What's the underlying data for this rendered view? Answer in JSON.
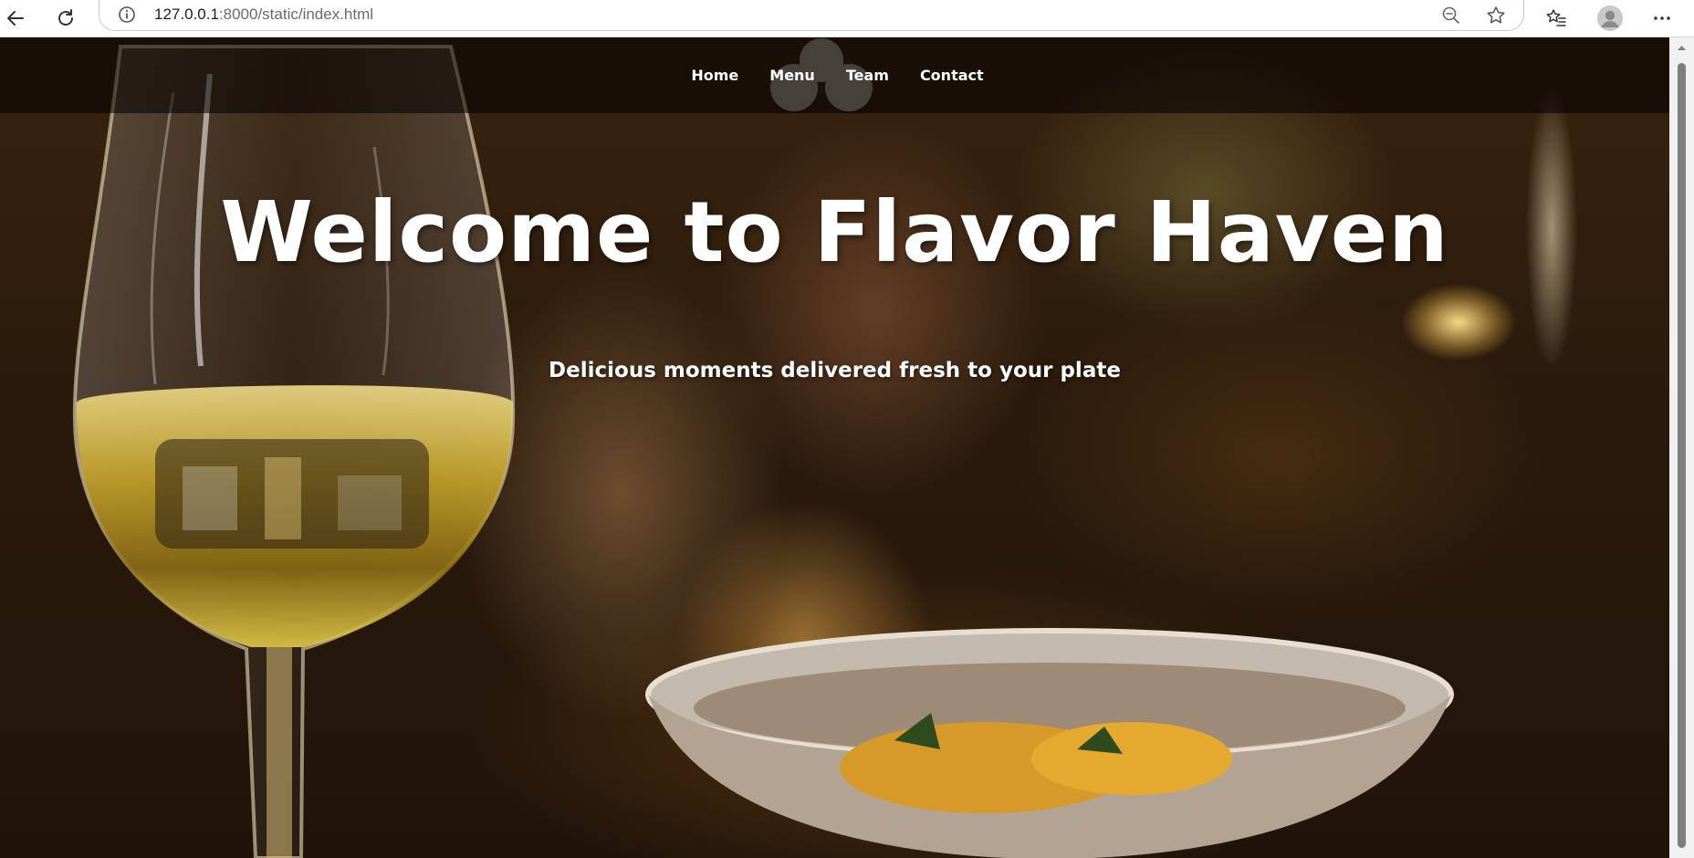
{
  "browser": {
    "url_host": "127.0.0.1",
    "url_rest": ":8000/static/index.html",
    "icons": [
      "back-arrow-icon",
      "reload-icon",
      "info-icon",
      "zoom-out-icon",
      "star-icon",
      "favorites-icon",
      "profile-icon",
      "more-icon"
    ]
  },
  "nav": {
    "links": [
      "Home",
      "Menu",
      "Team",
      "Contact"
    ]
  },
  "hero": {
    "title": "Welcome to Flavor Haven",
    "subtitle": "Delicious moments delivered fresh to your plate"
  },
  "colors": {
    "nav_background": "#000000",
    "text": "#ffffff",
    "scrollbar_thumb": "#7e7e7e"
  }
}
